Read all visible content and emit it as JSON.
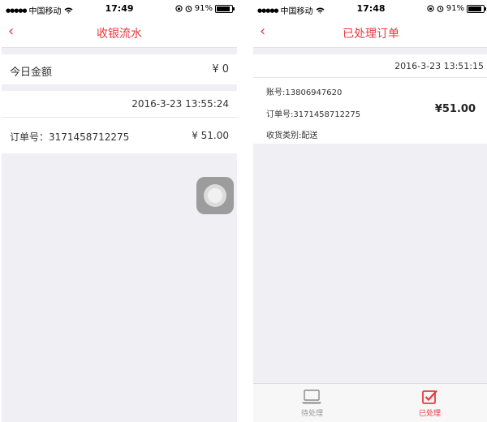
{
  "colors": {
    "accent": "#e8383d",
    "background": "#efeff4",
    "tab_inactive": "#999999"
  },
  "left_screen": {
    "status": {
      "carrier": "中国移动",
      "time": "17:49",
      "battery": "91%"
    },
    "nav": {
      "back_icon": "chevron-left-icon",
      "title": "收银流水"
    },
    "today": {
      "label": "今日金额",
      "value": "¥ 0"
    },
    "record": {
      "datetime": "2016-3-23 13:55:24",
      "order_label": "订单号：3171458712275",
      "amount": "¥ 51.00"
    }
  },
  "right_screen": {
    "status": {
      "carrier": "中国移动",
      "time": "17:48",
      "battery": "91%"
    },
    "nav": {
      "back_icon": "chevron-left-icon",
      "title": "已处理订单"
    },
    "order": {
      "datetime": "2016-3-23 13:51:15",
      "account": "账号:13806947620",
      "order_no": "订单号:3171458712275",
      "amount": "¥51.00",
      "delivery": "收货类别:配送"
    },
    "tabs": [
      {
        "label": "待处理",
        "icon": "laptop-icon",
        "active": false
      },
      {
        "label": "已处理",
        "icon": "checked-box-icon",
        "active": true
      }
    ]
  }
}
